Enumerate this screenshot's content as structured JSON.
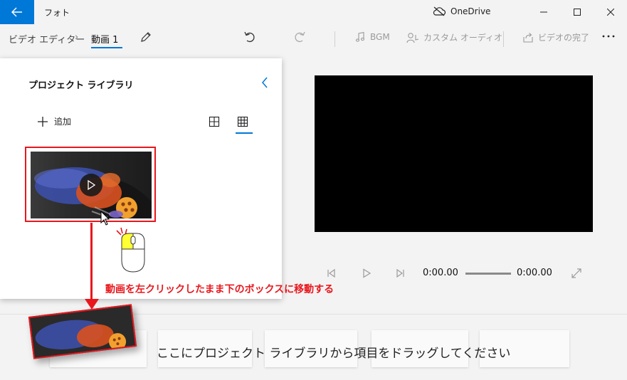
{
  "window": {
    "title": "フォト",
    "onedrive_label": "OneDrive"
  },
  "breadcrumb": {
    "parent": "ビデオ エディター",
    "current": "動画 1"
  },
  "toolbar": {
    "bgm_label": "BGM",
    "custom_audio_label": "カスタム オーディオ",
    "finish_video_label": "ビデオの完了"
  },
  "library": {
    "title": "プロジェクト ライブラリ",
    "add_label": "追加"
  },
  "player": {
    "current_time": "0:00.00",
    "duration": "0:00.00"
  },
  "storyboard": {
    "placeholder": "ここにプロジェクト ライブラリから項目をドラッグしてください"
  },
  "annotation": {
    "instruction": "動画を左クリックしたまま下のボックスに移動する"
  },
  "colors": {
    "accent": "#0078d7",
    "annotation": "#e8171d",
    "highlight": "#ffff33"
  }
}
